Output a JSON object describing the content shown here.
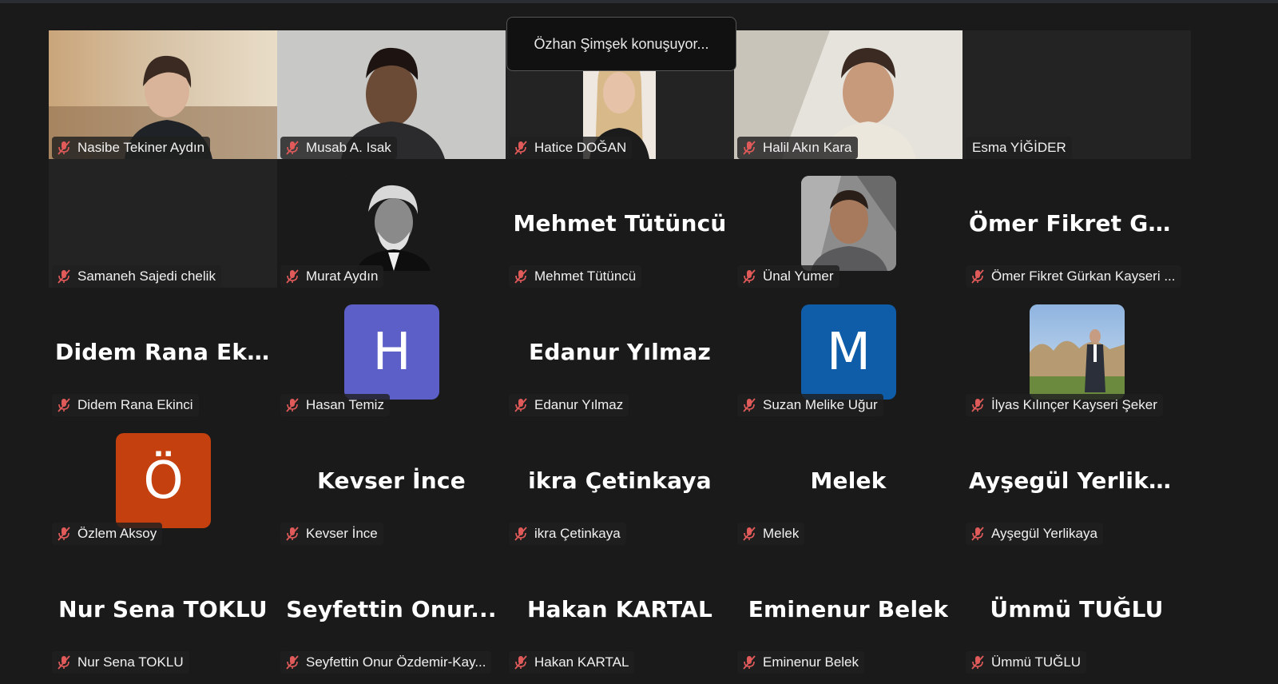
{
  "speaking_toast": "Özhan Şimşek konuşuyor...",
  "colors": {
    "background": "#1a1a1a",
    "tile_dark": "#232323",
    "muted_mic": "#e05a5a",
    "avatar_H": "#5b5fc7",
    "avatar_M": "#0f5ca8",
    "avatar_O": "#c4400f"
  },
  "participants": [
    {
      "name": "Nasibe Tekiner Aydın",
      "kind": "video",
      "muted": true
    },
    {
      "name": "Musab A. Isak",
      "kind": "video",
      "muted": true
    },
    {
      "name": "Hatice DOĞAN",
      "kind": "video",
      "muted": true
    },
    {
      "name": "Halil Akın Kara",
      "kind": "video",
      "muted": true
    },
    {
      "name": "Esma YİĞİDER",
      "kind": "dark",
      "muted": false
    },
    {
      "name": "Samaneh Sajedi chelik",
      "kind": "dark",
      "muted": true
    },
    {
      "name": "Murat Aydın",
      "kind": "photo",
      "muted": true
    },
    {
      "name": "Mehmet Tütüncü",
      "kind": "bigname",
      "big": "Mehmet Tütüncü",
      "muted": true
    },
    {
      "name": "Ünal Yumer",
      "kind": "photo",
      "muted": true
    },
    {
      "name": "Ömer Fikret Gürkan Kayseri ...",
      "kind": "bigname",
      "big": "Ömer Fikret Gü...",
      "muted": true
    },
    {
      "name": "Didem Rana Ekinci",
      "kind": "bigname",
      "big": "Didem Rana Eki...",
      "muted": true
    },
    {
      "name": "Hasan Temiz",
      "kind": "letter",
      "letter": "H",
      "muted": true
    },
    {
      "name": "Edanur Yılmaz",
      "kind": "bigname",
      "big": "Edanur Yılmaz",
      "muted": true
    },
    {
      "name": "Suzan Melike Uğur",
      "kind": "letter",
      "letter": "M",
      "muted": true
    },
    {
      "name": "İlyas Kılınçer Kayseri Şeker",
      "kind": "photo",
      "muted": true
    },
    {
      "name": "Özlem Aksoy",
      "kind": "letter",
      "letter": "Ö",
      "muted": true
    },
    {
      "name": "Kevser İnce",
      "kind": "bigname",
      "big": "Kevser İnce",
      "muted": true
    },
    {
      "name": "ikra Çetinkaya",
      "kind": "bigname",
      "big": "ikra Çetinkaya",
      "muted": true
    },
    {
      "name": "Melek",
      "kind": "bigname",
      "big": "Melek",
      "muted": true
    },
    {
      "name": "Ayşegül Yerlikaya",
      "kind": "bigname",
      "big": "Ayşegül Yerlikaya",
      "muted": true
    },
    {
      "name": "Nur Sena TOKLU",
      "kind": "bigname",
      "big": "Nur Sena TOKLU",
      "muted": true
    },
    {
      "name": "Seyfettin Onur Özdemir-Kay...",
      "kind": "bigname",
      "big": "Seyfettin Onur...",
      "muted": true
    },
    {
      "name": "Hakan KARTAL",
      "kind": "bigname",
      "big": "Hakan KARTAL",
      "muted": true
    },
    {
      "name": "Eminenur Belek",
      "kind": "bigname",
      "big": "Eminenur Belek",
      "muted": true
    },
    {
      "name": "Ümmü TUĞLU",
      "kind": "bigname",
      "big": "Ümmü TUĞLU",
      "muted": true
    }
  ]
}
